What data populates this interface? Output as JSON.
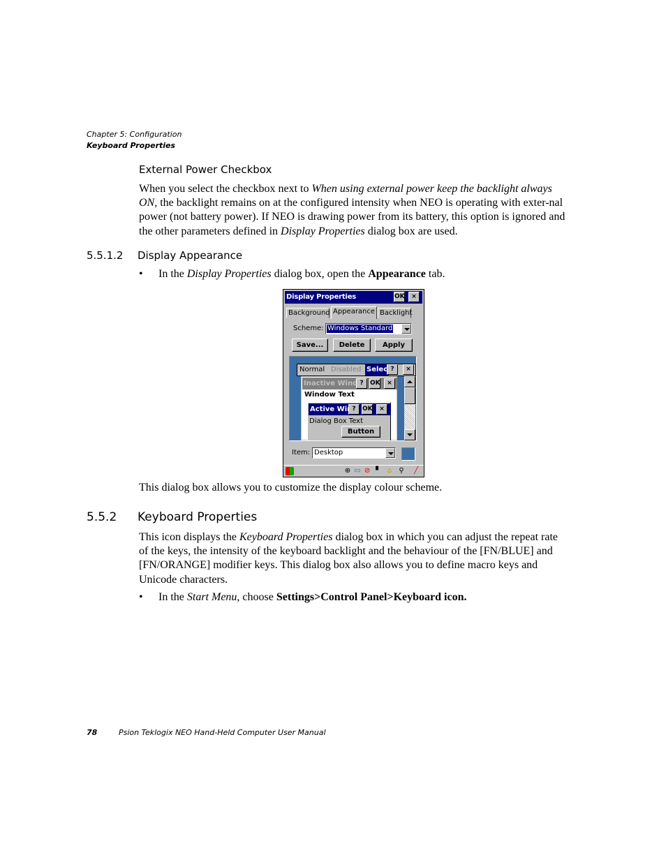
{
  "header": {
    "chapter": "Chapter 5:  Configuration",
    "section": "Keyboard Properties"
  },
  "external_power": {
    "heading": "External Power Checkbox",
    "para": {
      "t1": "When you select the checkbox next to ",
      "i1": "When using external power keep the backlight always ON",
      "t2": ", the backlight remains on at the configured intensity when NEO is operating with exter-nal power (not battery power). If NEO is drawing power from its battery, this option is ignored and the other parameters defined in ",
      "i2": "Display Properties",
      "t3": " dialog box are used."
    }
  },
  "display_appearance": {
    "number": "5.5.1.2",
    "heading": "Display Appearance",
    "bullet": {
      "dot": "•",
      "t1": "In the ",
      "i1": "Display Properties",
      "t2": " dialog box, open the ",
      "b1": "Appearance",
      "t3": " tab."
    },
    "caption": "This dialog box allows you to customize the display colour scheme."
  },
  "dialog": {
    "title": "Display Properties",
    "ok": "OK",
    "close": "×",
    "tabs": [
      "Background",
      "Appearance",
      "Backlight"
    ],
    "active_tab": "Appearance",
    "scheme_label": "Scheme:",
    "scheme_value": "Windows Standard",
    "buttons": {
      "save": "Save...",
      "delete": "Delete",
      "apply": "Apply"
    },
    "preview": {
      "menu": {
        "normal": "Normal",
        "disabled": "Disabled",
        "selected": "Selec"
      },
      "help": "?",
      "ok": "OK",
      "close": "×",
      "inactive_title": "Inactive Windo",
      "window_text": "Window Text",
      "active_title": "Active Win",
      "dialog_text": "Dialog Box Text",
      "button": "Button"
    },
    "item_label": "Item:",
    "item_value": "Desktop",
    "colors": {
      "titlebar": "#000080",
      "desktop": "#3a6ea5",
      "face": "#c0c0c0",
      "inactive": "#808080"
    }
  },
  "keyboard_properties": {
    "number": "5.5.2",
    "heading": "Keyboard Properties",
    "para": {
      "t1": "This icon displays the ",
      "i1": "Keyboard Properties",
      "t2": " dialog box in which you can adjust the repeat rate of the keys, the intensity of the keyboard backlight and the behaviour of the [FN/BLUE] and [FN/ORANGE] modifier keys. This dialog box also allows you to define macro keys and Unicode characters."
    },
    "bullet": {
      "dot": "•",
      "t1": "In the ",
      "i1": "Start Menu",
      "t2": ", choose ",
      "b1": "Settings>Control Panel>Keyboard icon."
    }
  },
  "footer": {
    "page": "78",
    "title": "Psion Teklogix NEO Hand-Held Computer User Manual"
  }
}
